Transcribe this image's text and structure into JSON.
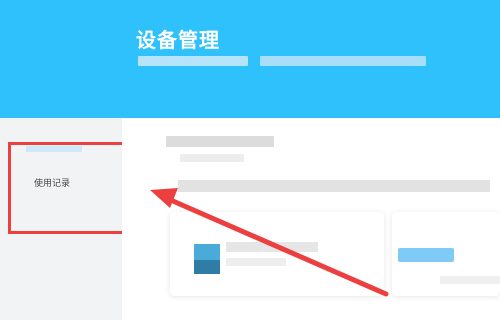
{
  "header": {
    "title": "设备管理"
  },
  "sidebar": {
    "items": [
      {
        "label": "使用记录"
      }
    ]
  },
  "colors": {
    "header_bg": "#2ec1fb",
    "highlight": "#ec3f3f",
    "arrow": "#ec3f3f"
  },
  "icons": [
    "annotation-arrow-icon"
  ]
}
